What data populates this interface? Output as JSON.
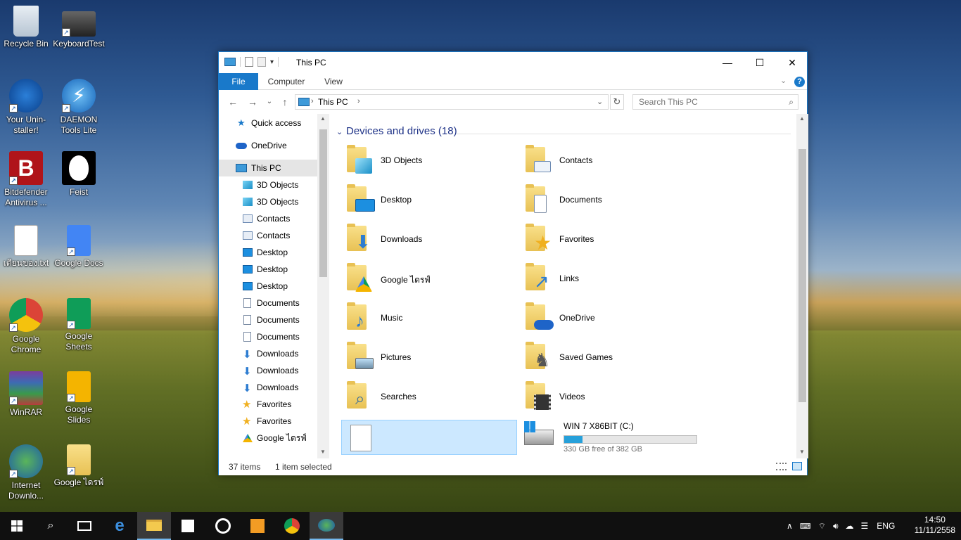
{
  "desktop": {
    "icons": [
      {
        "label": "Recycle Bin"
      },
      {
        "label": "KeyboardTest"
      },
      {
        "label": "Your Unin-staller!"
      },
      {
        "label": "DAEMON Tools Lite"
      },
      {
        "label": "Bitdefender Antivirus ..."
      },
      {
        "label": "Feist"
      },
      {
        "label": "เตียนของ.txt"
      },
      {
        "label": "Google Docs"
      },
      {
        "label": "Google Chrome"
      },
      {
        "label": "Google Sheets"
      },
      {
        "label": "WinRAR"
      },
      {
        "label": "Google Slides"
      },
      {
        "label": "Internet Downlo..."
      },
      {
        "label": "Google ไดรฟ์"
      }
    ]
  },
  "window": {
    "title": "This PC",
    "ribbon_tabs": [
      "File",
      "Computer",
      "View"
    ],
    "address": "This PC",
    "search_placeholder": "Search This PC",
    "nav_items": [
      {
        "label": "Quick access",
        "icon": "star-icon"
      },
      {
        "label": "OneDrive",
        "icon": "cloud-icon"
      },
      {
        "label": "This PC",
        "icon": "computer-icon"
      },
      {
        "label": "3D Objects",
        "icon": "cube-icon"
      },
      {
        "label": "3D Objects",
        "icon": "cube-icon"
      },
      {
        "label": "Contacts",
        "icon": "contact-card-icon"
      },
      {
        "label": "Contacts",
        "icon": "contact-card-icon"
      },
      {
        "label": "Desktop",
        "icon": "desktop-icon"
      },
      {
        "label": "Desktop",
        "icon": "desktop-icon"
      },
      {
        "label": "Desktop",
        "icon": "desktop-icon"
      },
      {
        "label": "Documents",
        "icon": "document-icon"
      },
      {
        "label": "Documents",
        "icon": "document-icon"
      },
      {
        "label": "Documents",
        "icon": "document-icon"
      },
      {
        "label": "Downloads",
        "icon": "download-arrow-icon"
      },
      {
        "label": "Downloads",
        "icon": "download-arrow-icon"
      },
      {
        "label": "Downloads",
        "icon": "download-arrow-icon"
      },
      {
        "label": "Favorites",
        "icon": "favorites-star-icon"
      },
      {
        "label": "Favorites",
        "icon": "favorites-star-icon"
      },
      {
        "label": "Google ไดรฟ์",
        "icon": "google-drive-icon"
      }
    ],
    "group_header": "Devices and drives (18)",
    "folders": [
      {
        "label": "3D Objects",
        "icon": "cube-icon"
      },
      {
        "label": "Contacts",
        "icon": "contact-card-icon"
      },
      {
        "label": "Desktop",
        "icon": "desktop-icon"
      },
      {
        "label": "Documents",
        "icon": "document-icon"
      },
      {
        "label": "Downloads",
        "icon": "download-arrow-icon"
      },
      {
        "label": "Favorites",
        "icon": "favorites-star-icon"
      },
      {
        "label": "Google ไดรฟ์",
        "icon": "google-drive-icon"
      },
      {
        "label": "Links",
        "icon": "link-arrow-icon"
      },
      {
        "label": "Music",
        "icon": "music-note-icon"
      },
      {
        "label": "OneDrive",
        "icon": "cloud-icon"
      },
      {
        "label": "Pictures",
        "icon": "picture-icon"
      },
      {
        "label": "Saved Games",
        "icon": "chess-piece-icon"
      },
      {
        "label": "Searches",
        "icon": "magnifier-icon"
      },
      {
        "label": "Videos",
        "icon": "film-icon"
      }
    ],
    "drive": {
      "name": "WIN 7 X86BIT (C:)",
      "free_text": "330 GB free of 382 GB",
      "used_fraction": 0.136
    },
    "status": {
      "items": "37 items",
      "selected": "1 item selected"
    }
  },
  "taskbar": {
    "apps": [
      "start-icon",
      "search-icon",
      "task-view-icon",
      "edge-icon",
      "file-explorer-icon",
      "store-icon",
      "groove-icon",
      "video-icon",
      "chrome-icon",
      "idm-icon"
    ],
    "lang": "ENG",
    "time": "14:50",
    "date": "11/11/2558"
  }
}
